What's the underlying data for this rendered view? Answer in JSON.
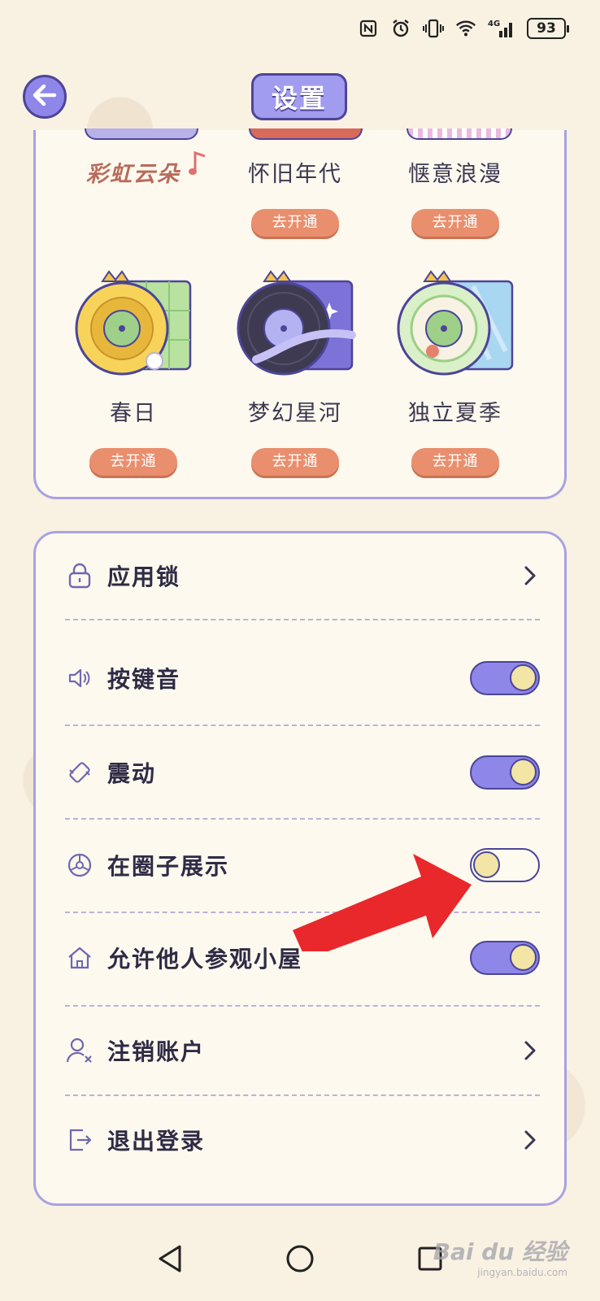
{
  "status_bar": {
    "icons": [
      "nfc-icon",
      "alarm-icon",
      "vibrate-icon",
      "wifi-icon",
      "signal-4g-icon"
    ],
    "signal_label": "4G",
    "battery": "93"
  },
  "header": {
    "title": "设置",
    "back_icon": "arrow-left-icon"
  },
  "themes": {
    "partial_row": [
      {
        "name": "彩虹云朵",
        "button": null
      },
      {
        "name": "怀旧年代",
        "button": "去开通"
      },
      {
        "name": "惬意浪漫",
        "button": "去开通"
      }
    ],
    "full_row": [
      {
        "name": "春日",
        "button": "去开通"
      },
      {
        "name": "梦幻星河",
        "button": "去开通"
      },
      {
        "name": "独立夏季",
        "button": "去开通"
      }
    ]
  },
  "settings": {
    "items": [
      {
        "label": "应用锁",
        "icon": "lock-icon",
        "control": "chevron"
      },
      {
        "label": "按键音",
        "icon": "speaker-icon",
        "control": "toggle",
        "on": true
      },
      {
        "label": "震动",
        "icon": "vibration-icon",
        "control": "toggle",
        "on": true
      },
      {
        "label": "在圈子展示",
        "icon": "circle-icon",
        "control": "toggle",
        "on": false
      },
      {
        "label": "允许他人参观小屋",
        "icon": "house-icon",
        "control": "toggle",
        "on": true
      },
      {
        "label": "注销账户",
        "icon": "user-remove-icon",
        "control": "chevron"
      },
      {
        "label": "退出登录",
        "icon": "logout-icon",
        "control": "chevron"
      }
    ]
  },
  "colors": {
    "accent": "#8e86e8",
    "accent_dark": "#4c4598",
    "button_orange": "#e98f6e",
    "knob": "#f2e5a5",
    "background": "#f9f1e2",
    "arrow": "#e8282b"
  },
  "watermark": {
    "brand": "Bai du 经验",
    "url": "jingyan.baidu.com"
  },
  "nav": [
    "back-triangle-icon",
    "home-circle-icon",
    "recents-square-icon"
  ]
}
